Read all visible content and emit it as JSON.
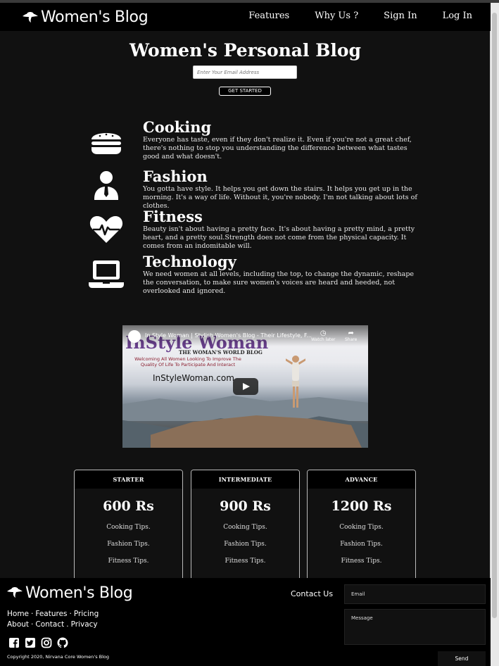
{
  "brand": {
    "name": "Women's Blog",
    "logo_icon": "hat-lady-logo-icon"
  },
  "nav": {
    "links": [
      "Features",
      "Why Us ?",
      "Sign In",
      "Log In"
    ]
  },
  "hero": {
    "title": "Women's Personal Blog",
    "email_placeholder": "Enter Your Email Address",
    "cta_label": "GET STARTED"
  },
  "features": [
    {
      "icon": "burger-icon",
      "title": "Cooking",
      "text": "Everyone has taste, even if they don't realize it. Even if you're not a great chef, there's nothing to stop you understanding the difference between what tastes good and what doesn't."
    },
    {
      "icon": "user-tie-icon",
      "title": "Fashion",
      "text": "You gotta have style. It helps you get down the stairs. It helps you get up in the morning. It's a way of life. Without it, you're nobody. I'm not talking about lots of clothes."
    },
    {
      "icon": "heartbeat-icon",
      "title": "Fitness",
      "text": "Beauty isn't about having a pretty face. It's about having a pretty mind, a pretty heart, and a pretty soul.Strength does not come from the physical capacity. It comes from an indomitable will."
    },
    {
      "icon": "laptop-icon",
      "title": "Technology",
      "text": "We need women at all levels, including the top, to change the dynamic, reshape the conversation, to make sure women's voices are heard and heeded, not overlooked and ignored."
    }
  ],
  "video": {
    "title": "In Style Woman | Stylish Women's Blog - Their Lifestyle, F...",
    "watch_later": "Watch later",
    "share": "Share",
    "thumb_brand": "InStyle Woman",
    "thumb_sub": "THE WOMAN'S WORLD BLOG",
    "thumb_welcome": "Welcoming All Women Looking To Improve The Quality Of Life To Participate And Interact",
    "thumb_site": "InStyleWoman.com"
  },
  "pricing": [
    {
      "name": "STARTER",
      "price": "600 Rs",
      "items": [
        "Cooking Tips.",
        "Fashion Tips.",
        "Fitness Tips."
      ]
    },
    {
      "name": "INTERMEDIATE",
      "price": "900 Rs",
      "items": [
        "Cooking Tips.",
        "Fashion Tips.",
        "Fitness Tips."
      ]
    },
    {
      "name": "ADVANCE",
      "price": "1200 Rs",
      "items": [
        "Cooking Tips.",
        "Fashion Tips.",
        "Fitness Tips."
      ]
    }
  ],
  "footer": {
    "links_row1": [
      "Home",
      "Features",
      "Pricing"
    ],
    "links_row2": [
      "About",
      "Contact",
      "Privacy"
    ],
    "social_icons": [
      "facebook-icon",
      "twitter-icon",
      "instagram-icon",
      "github-icon"
    ],
    "copyright": "Copyright 2020, Nirvana Core Women's Blog",
    "contact_label": "Contact Us",
    "email_placeholder": "Email",
    "message_placeholder": "Message",
    "send_label": "Send"
  }
}
